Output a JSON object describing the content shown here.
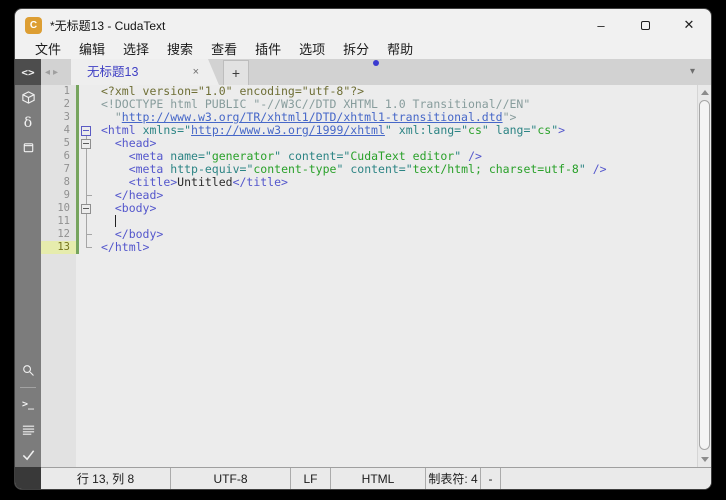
{
  "window": {
    "title": "*无标题13 - CudaText",
    "app_icon_letter": "C",
    "controls": {
      "minimize": "–",
      "close": "✕"
    }
  },
  "menubar": {
    "items": [
      "文件",
      "编辑",
      "选择",
      "搜索",
      "查看",
      "插件",
      "选项",
      "拆分",
      "帮助"
    ]
  },
  "tabbar": {
    "nav_left": "◂",
    "nav_right": "▸",
    "active_tab_label": "无标题13",
    "close_label": "×",
    "new_tab_label": "+",
    "menu_arrow": "▾"
  },
  "sidebar": {
    "code_glyph": "<>",
    "delta_glyph": "δ",
    "console_glyph": ">_"
  },
  "editor": {
    "lines": [
      {
        "fold": "",
        "tokens": [
          [
            "pi",
            "<?xml version=\"1.0\" encoding=\"utf-8\"?>"
          ]
        ]
      },
      {
        "fold": "",
        "tokens": [
          [
            "doc",
            "<!DOCTYPE html PUBLIC \"-//W3C//DTD XHTML 1.0 Transitional//EN\""
          ]
        ]
      },
      {
        "fold": "",
        "tokens": [
          [
            "doc",
            "  \""
          ],
          [
            "url",
            "http://www.w3.org/TR/xhtml1/DTD/xhtml1-transitional.dtd"
          ],
          [
            "doc",
            "\">"
          ]
        ]
      },
      {
        "fold": "box-active vbelow",
        "tokens": [
          [
            "tag",
            "<html"
          ],
          [
            "plain",
            " "
          ],
          [
            "attr",
            "xmlns="
          ],
          [
            "q",
            "\""
          ],
          [
            "url",
            "http://www.w3.org/1999/xhtml"
          ],
          [
            "q",
            "\""
          ],
          [
            "plain",
            " "
          ],
          [
            "attr",
            "xml:lang="
          ],
          [
            "q",
            "\""
          ],
          [
            "str",
            "cs"
          ],
          [
            "q",
            "\""
          ],
          [
            "plain",
            " "
          ],
          [
            "attr",
            "lang="
          ],
          [
            "q",
            "\""
          ],
          [
            "str",
            "cs"
          ],
          [
            "q",
            "\""
          ],
          [
            "tag",
            ">"
          ]
        ]
      },
      {
        "fold": "line box",
        "tokens": [
          [
            "plain",
            "  "
          ],
          [
            "tag",
            "<head>"
          ]
        ]
      },
      {
        "fold": "line",
        "tokens": [
          [
            "plain",
            "    "
          ],
          [
            "tag",
            "<meta"
          ],
          [
            "plain",
            " "
          ],
          [
            "attr",
            "name="
          ],
          [
            "q",
            "\""
          ],
          [
            "str",
            "generator"
          ],
          [
            "q",
            "\""
          ],
          [
            "plain",
            " "
          ],
          [
            "attr",
            "content="
          ],
          [
            "q",
            "\""
          ],
          [
            "str",
            "CudaText editor"
          ],
          [
            "q",
            "\""
          ],
          [
            "plain",
            " "
          ],
          [
            "tag",
            "/>"
          ]
        ]
      },
      {
        "fold": "line",
        "tokens": [
          [
            "plain",
            "    "
          ],
          [
            "tag",
            "<meta"
          ],
          [
            "plain",
            " "
          ],
          [
            "attr",
            "http-equiv="
          ],
          [
            "q",
            "\""
          ],
          [
            "str",
            "content-type"
          ],
          [
            "q",
            "\""
          ],
          [
            "plain",
            " "
          ],
          [
            "attr",
            "content="
          ],
          [
            "q",
            "\""
          ],
          [
            "str",
            "text/html; charset=utf-8"
          ],
          [
            "q",
            "\""
          ],
          [
            "plain",
            " "
          ],
          [
            "tag",
            "/>"
          ]
        ]
      },
      {
        "fold": "line",
        "tokens": [
          [
            "plain",
            "    "
          ],
          [
            "tag",
            "<title>"
          ],
          [
            "txt",
            "Untitled"
          ],
          [
            "tag",
            "</title>"
          ]
        ]
      },
      {
        "fold": "line tick",
        "tokens": [
          [
            "plain",
            "  "
          ],
          [
            "tag",
            "</head>"
          ]
        ]
      },
      {
        "fold": "line box",
        "tokens": [
          [
            "plain",
            "  "
          ],
          [
            "tag",
            "<body>"
          ]
        ]
      },
      {
        "fold": "line",
        "tokens": [
          [
            "plain",
            "  "
          ],
          [
            "caret",
            ""
          ]
        ]
      },
      {
        "fold": "line tick",
        "tokens": [
          [
            "plain",
            "  "
          ],
          [
            "tag",
            "</body>"
          ]
        ]
      },
      {
        "fold": "corner-v corner-h",
        "current": true,
        "tokens": [
          [
            "tag",
            "</html>"
          ]
        ]
      }
    ]
  },
  "statusbar": {
    "cells": [
      {
        "name": "caret-position",
        "label": "行 13, 列 8"
      },
      {
        "name": "encoding",
        "label": "UTF-8"
      },
      {
        "name": "line-endings",
        "label": "LF"
      },
      {
        "name": "lexer",
        "label": "HTML"
      },
      {
        "name": "tab-size",
        "label": "制表符: 4"
      },
      {
        "name": "selection",
        "label": "-"
      }
    ]
  },
  "colors": {
    "accent_tab_text": "#3f3fc4",
    "modified_dot": "#3b3bd0",
    "changed_lines_strip": "#76a45e",
    "app_icon": "#dd9e33",
    "sidebar": "#7c7c7c",
    "editor_bg": "#ececec"
  }
}
